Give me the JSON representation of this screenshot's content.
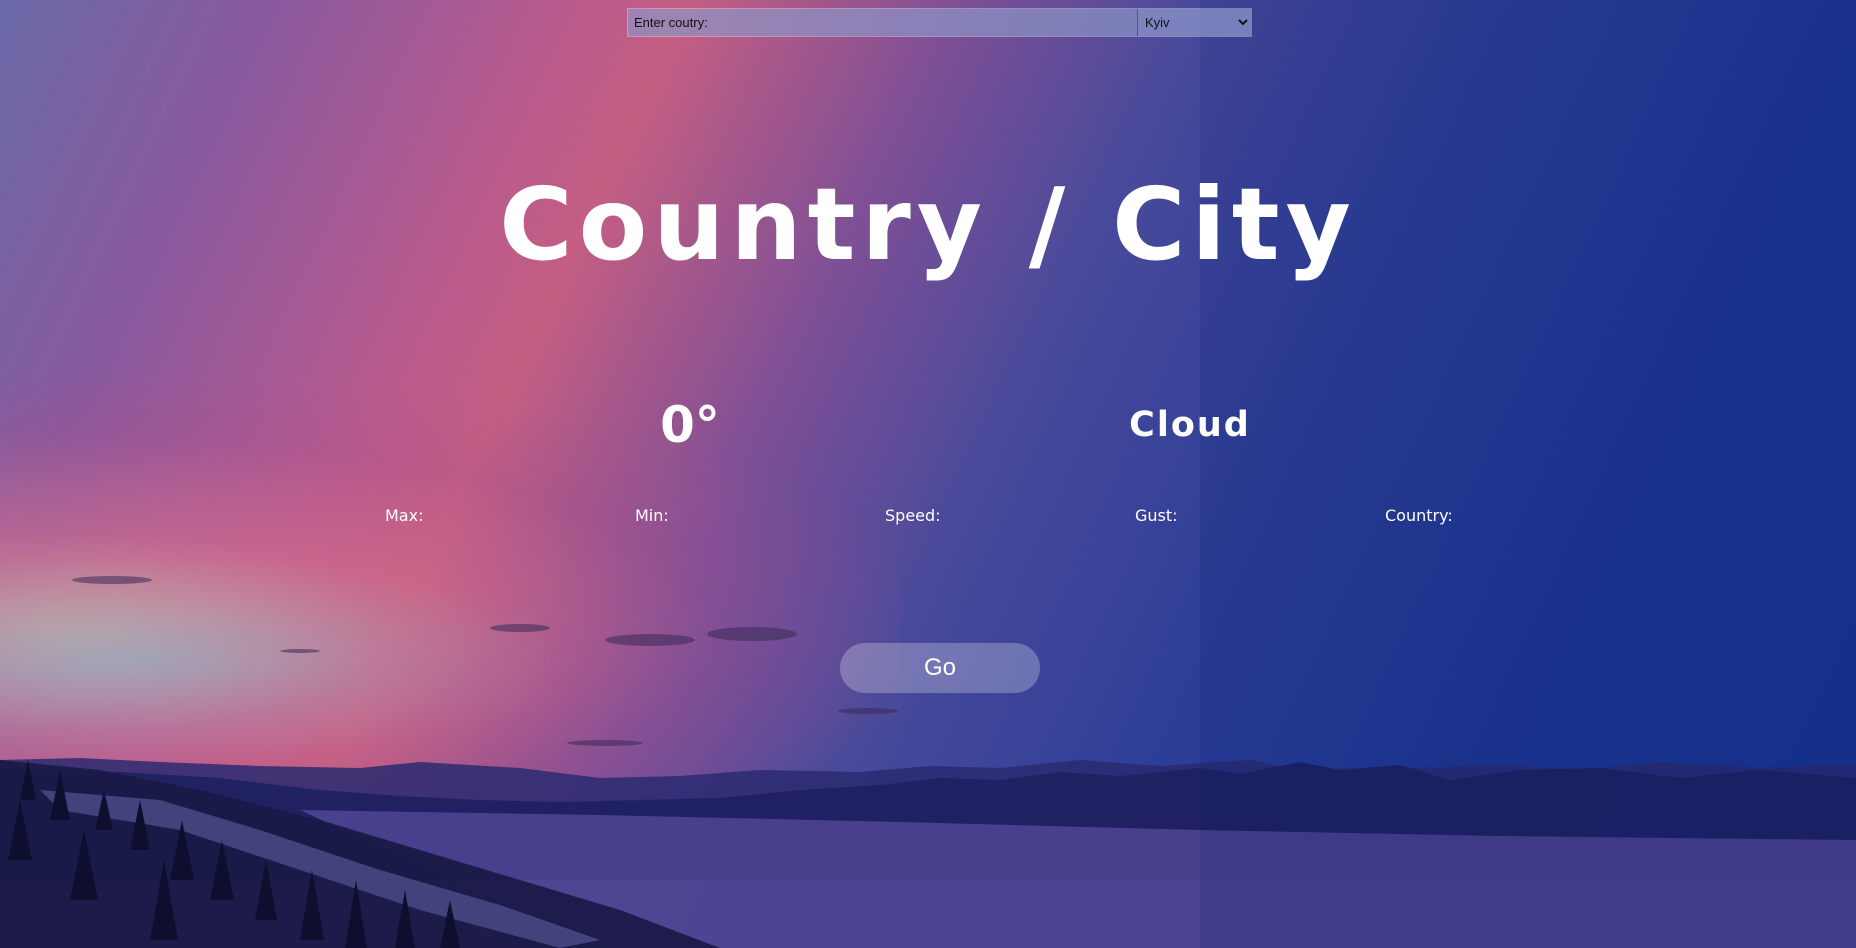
{
  "search": {
    "placeholder": "Enter coutry:",
    "value": ""
  },
  "city_select": {
    "selected": "Kyiv",
    "options": [
      "Kyiv"
    ]
  },
  "header": {
    "title": "Country / City"
  },
  "weather": {
    "temperature": "0°",
    "condition": "Cloud"
  },
  "stats": {
    "max_label": "Max:",
    "min_label": "Min:",
    "speed_label": "Speed:",
    "gust_label": "Gust:",
    "country_label": "Country:"
  },
  "actions": {
    "go_label": "Go"
  },
  "colors": {
    "text": "#ffffff",
    "sky_top": "#163391",
    "sky_pink": "#c45e82",
    "button_bg": "rgba(255,255,255,0.25)"
  }
}
